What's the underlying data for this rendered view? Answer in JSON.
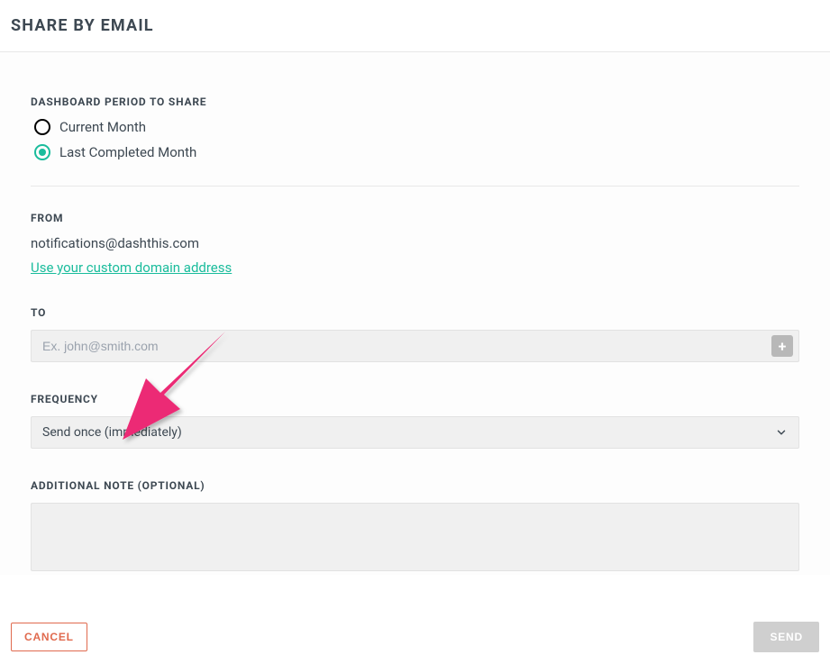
{
  "title": "SHARE BY EMAIL",
  "period": {
    "label": "DASHBOARD PERIOD TO SHARE",
    "options": {
      "current": "Current Month",
      "last": "Last Completed Month"
    }
  },
  "from": {
    "label": "FROM",
    "email": "notifications@dashthis.com",
    "custom_link": "Use your custom domain address"
  },
  "to": {
    "label": "TO",
    "placeholder": "Ex. john@smith.com"
  },
  "frequency": {
    "label": "FREQUENCY",
    "value": "Send once (immediately)"
  },
  "note": {
    "label": "ADDITIONAL NOTE (OPTIONAL)"
  },
  "footer": {
    "cancel": "CANCEL",
    "send": "SEND"
  }
}
